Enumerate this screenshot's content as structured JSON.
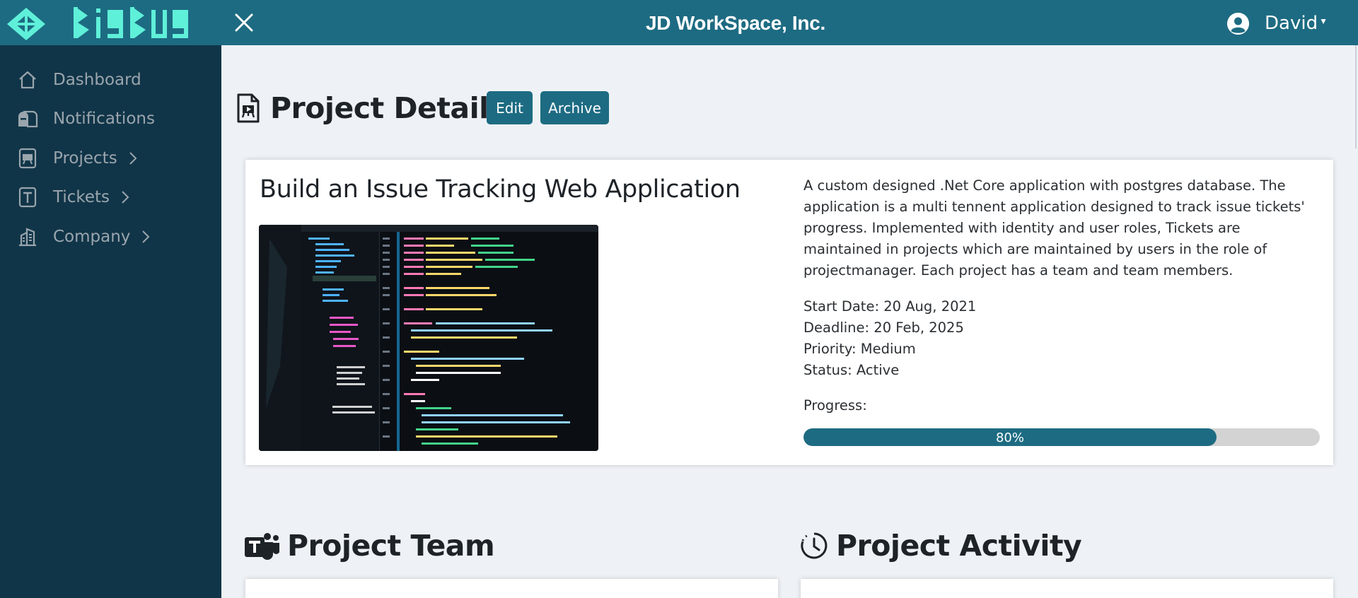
{
  "brand": {
    "logo_text": "BigBug",
    "logo_glyphs": "ᗺᎥᘜᗷᑌᘜ"
  },
  "header": {
    "org_name": "JD WorkSpace, Inc.",
    "user_name": "David"
  },
  "sidebar": {
    "items": [
      {
        "label": "Dashboard",
        "icon": "house-icon",
        "has_submenu": false
      },
      {
        "label": "Notifications",
        "icon": "mailbox-icon",
        "has_submenu": false
      },
      {
        "label": "Projects",
        "icon": "file-easel-icon",
        "has_submenu": true
      },
      {
        "label": "Tickets",
        "icon": "file-text-icon",
        "has_submenu": true
      },
      {
        "label": "Company",
        "icon": "building-icon",
        "has_submenu": true
      }
    ]
  },
  "page": {
    "title": "Project Details",
    "edit_label": "Edit",
    "archive_label": "Archive"
  },
  "project": {
    "name": "Build an Issue Tracking Web Application",
    "description": "A custom designed .Net Core application with postgres database. The application is a multi tennent application designed to track issue tickets' progress. Implemented with identity and user roles, Tickets are maintained in projects which are maintained by users in the role of projectmanager. Each project has a team and team members.",
    "start_date": "Start Date: 20 Aug, 2021",
    "deadline": "Deadline: 20 Feb, 2025",
    "priority": "Priority: Medium",
    "status": "Status: Active",
    "progress_label": "Progress:",
    "progress_value": 80,
    "progress_text": "80%"
  },
  "sections": {
    "team_title": "Project Team",
    "activity_title": "Project Activity"
  },
  "colors": {
    "primary": "#1d6b82",
    "sidebar_bg": "#113548",
    "logo_accent": "#5ff0d9",
    "page_bg": "#eef2f6",
    "progress_track": "#d3d3d3"
  }
}
